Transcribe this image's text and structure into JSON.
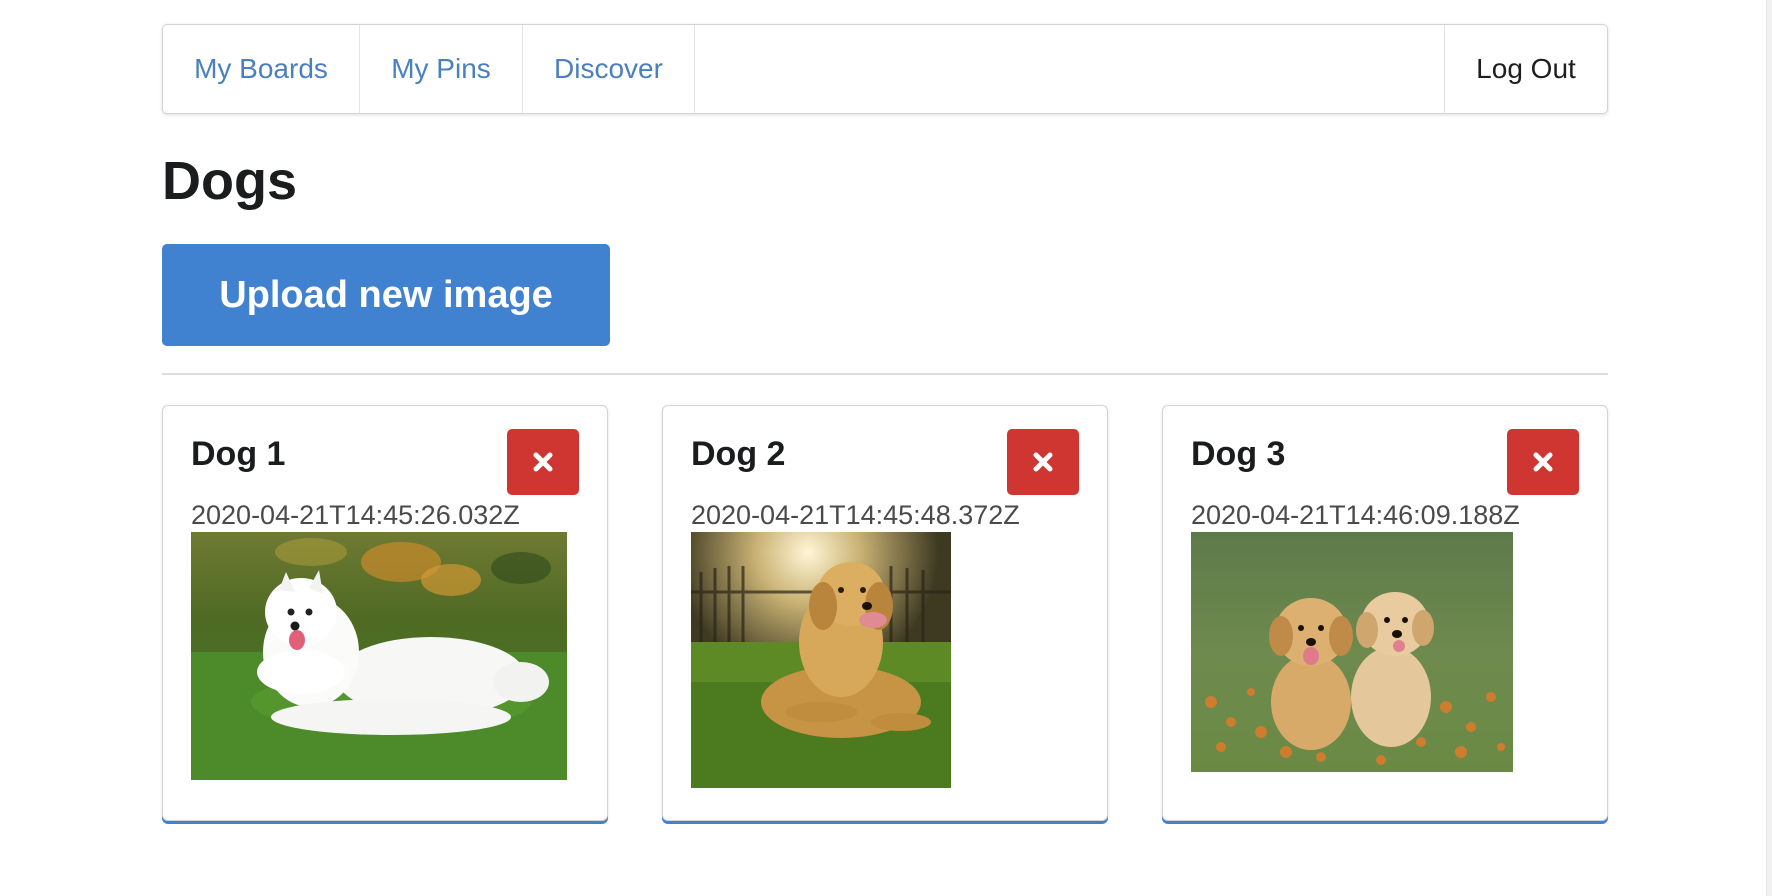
{
  "nav": {
    "items": [
      {
        "label": "My Boards"
      },
      {
        "label": "My Pins"
      },
      {
        "label": "Discover"
      }
    ],
    "logout_label": "Log Out"
  },
  "board": {
    "title": "Dogs",
    "upload_label": "Upload new image"
  },
  "pins": [
    {
      "title": "Dog 1",
      "date": "2020-04-21T14:45:26.032Z",
      "delete_icon": "close-icon"
    },
    {
      "title": "Dog 2",
      "date": "2020-04-21T14:45:48.372Z",
      "delete_icon": "close-icon"
    },
    {
      "title": "Dog 3",
      "date": "2020-04-21T14:46:09.188Z",
      "delete_icon": "close-icon"
    }
  ],
  "colors": {
    "accent": "#4182d0",
    "link": "#4a7fc0",
    "danger": "#cf3632"
  }
}
